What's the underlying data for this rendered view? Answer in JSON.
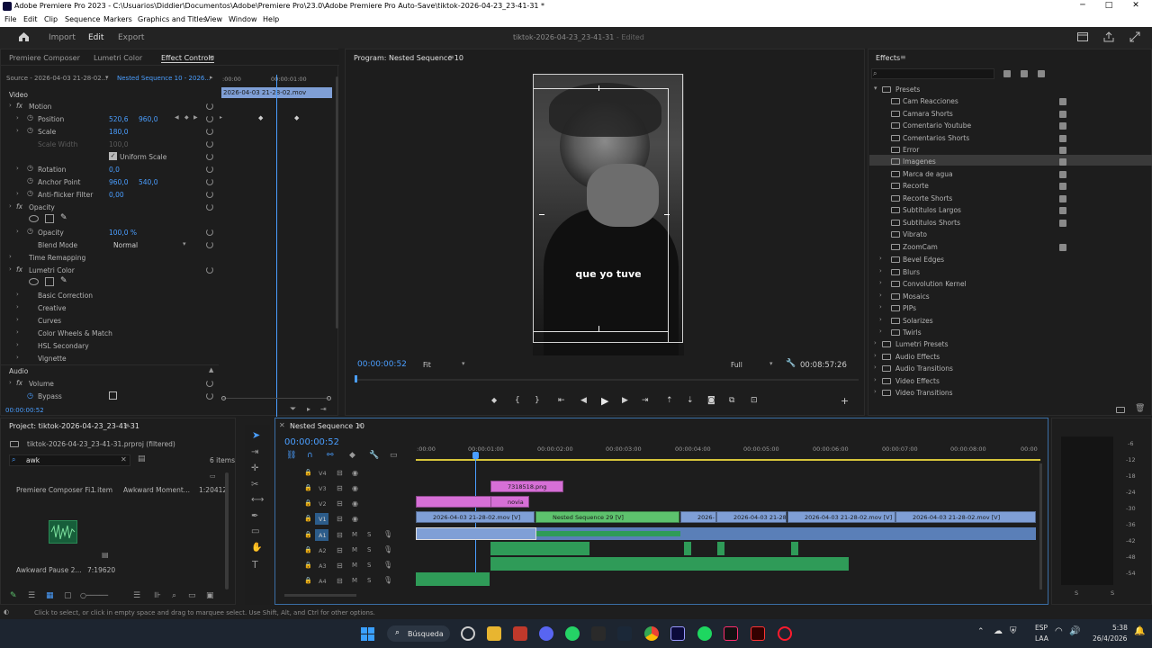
{
  "window": {
    "title": "Adobe Premiere Pro 2023 - C:\\Usuarios\\Diddier\\Documentos\\Adobe\\Premiere Pro\\23.0\\Adobe Premiere Pro Auto-Save\\tiktok-2026-04-23_23-41-31 *"
  },
  "menu": [
    "File",
    "Edit",
    "Clip",
    "Sequence",
    "Markers",
    "Graphics and Titles",
    "View",
    "Window",
    "Help"
  ],
  "workspace": {
    "tabs": [
      "Import",
      "Edit",
      "Export"
    ],
    "project_title": "tiktok-2026-04-23_23-41-31",
    "status": "- Edited"
  },
  "left_panel": {
    "tabs": [
      "Premiere Composer",
      "Lumetri Color",
      "Effect Controls"
    ],
    "source": "Source - 2026-04-03 21-28-02...",
    "sequence": "Nested Sequence 10 - 2026...",
    "ruler_start": ":00:00",
    "ruler_mid": "00:00:01:00",
    "clip_label": "2026-04-03 21-28-02.mov",
    "video_header": "Video",
    "motion": "Motion",
    "position": "Position",
    "pos_x": "520,6",
    "pos_y": "960,0",
    "scale": "Scale",
    "scale_val": "180,0",
    "scale_width": "Scale Width",
    "scale_width_val": "100,0",
    "uniform": "Uniform Scale",
    "rotation": "Rotation",
    "rotation_val": "0,0",
    "anchor": "Anchor Point",
    "anchor_x": "960,0",
    "anchor_y": "540,0",
    "antiflicker": "Anti-flicker Filter",
    "antiflicker_val": "0,00",
    "opacity_group": "Opacity",
    "opacity": "Opacity",
    "opacity_val": "100,0 %",
    "blend": "Blend Mode",
    "blend_val": "Normal",
    "time_remap": "Time Remapping",
    "lumetri": "Lumetri Color",
    "basic": "Basic Correction",
    "creative": "Creative",
    "curves": "Curves",
    "wheels": "Color Wheels & Match",
    "hsl": "HSL Secondary",
    "vignette": "Vignette",
    "audio_header": "Audio",
    "volume": "Volume",
    "bypass": "Bypass",
    "timecode": "00:00:00:52"
  },
  "program": {
    "title": "Program: Nested Sequence 10",
    "timecode": "00:00:00:52",
    "fit": "Fit",
    "full": "Full",
    "duration": "00:08:57:26",
    "caption": "que yo tuve"
  },
  "effects": {
    "title": "Effects",
    "presets": "Presets",
    "preset_items": [
      "Cam Reacciones",
      "Camara Shorts",
      "Comentario Youtube",
      "Comentarios Shorts",
      "Error",
      "Imagenes",
      "Marca de agua",
      "Recorte",
      "Recorte Shorts",
      "Subtitulos Largos",
      "Subtitulos Shorts",
      "Vibrato",
      "ZoomCam"
    ],
    "groups": [
      "Bevel Edges",
      "Blurs",
      "Convolution Kernel",
      "Mosaics",
      "PIPs",
      "Solarizes",
      "Twirls"
    ],
    "categories": [
      "Lumetri Presets",
      "Audio Effects",
      "Audio Transitions",
      "Video Effects",
      "Video Transitions"
    ]
  },
  "project": {
    "title": "Project: tiktok-2026-04-23_23-41-31",
    "file": "tiktok-2026-04-23_23-41-31.prproj (filtered)",
    "search": "awk",
    "count": "6 items",
    "item1_name": "Premiere Composer Fi...",
    "item1_meta": "1 item",
    "item2_name": "Awkward Moment...",
    "item2_meta": "1:20412",
    "item3_name": "Awkward Pause 2...",
    "item3_meta": "7:19620"
  },
  "timeline": {
    "title": "Nested Sequence 10",
    "timecode": "00:00:00:52",
    "ruler": [
      ":00:00",
      "00:00:01:00",
      "00:00:02:00",
      "00:00:03:00",
      "00:00:04:00",
      "00:00:05:00",
      "00:00:06:00",
      "00:00:07:00",
      "00:00:08:00",
      "00:00"
    ],
    "tracks": [
      "V4",
      "V3",
      "V2",
      "V1",
      "A1",
      "A2",
      "A3",
      "A4"
    ],
    "clip_png": "7318518.png",
    "clip_novia": "novia",
    "clip_v1a": "2026-04-03 21-28-02.mov [V]",
    "clip_nested": "Nested Sequence 29 [V]",
    "clip_v1b": "2026-",
    "clip_v1c": "2026-04-03 21-28-02.",
    "clip_v1d": "2026-04-03 21-28-02.mov [V]",
    "clip_v1e": "2026-04-03 21-28-02.mov [V]"
  },
  "meter": {
    "scale": [
      "-6",
      "-12",
      "-18",
      "-24",
      "-30",
      "-36",
      "-42",
      "-48",
      "-54"
    ],
    "s_label": "S"
  },
  "status_bar": "Click to select, or click in empty space and drag to marquee select. Use Shift, Alt, and Ctrl for other options.",
  "taskbar": {
    "search": "Búsqueda",
    "lang1": "ESP",
    "lang2": "LAA",
    "time": "5:38",
    "date": "26/4/2026"
  },
  "colors": {
    "accent": "#4a9eff",
    "v_clip": "#7f9fd6",
    "pink_clip": "#d66fd6",
    "green_clip": "#5dc26d",
    "audio_green": "#2f9b58"
  }
}
